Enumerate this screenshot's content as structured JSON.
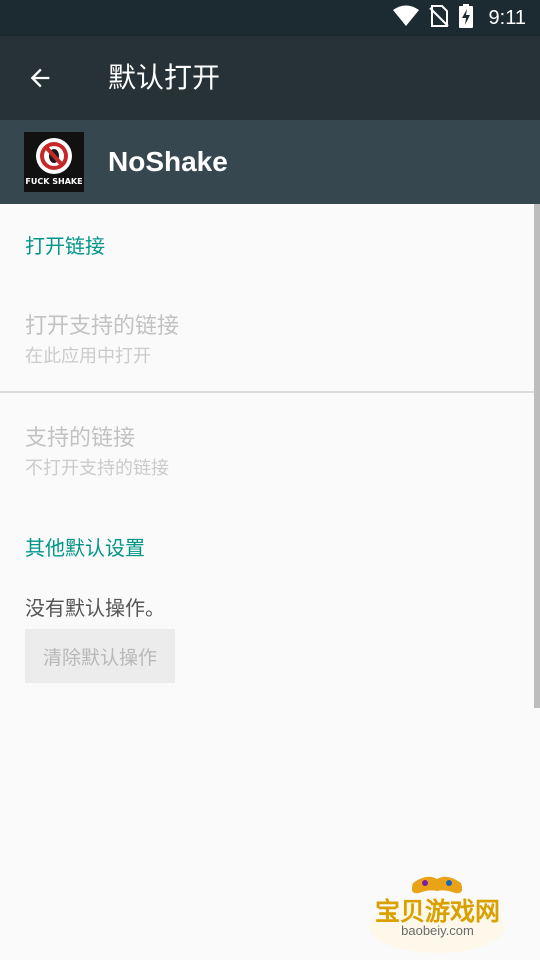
{
  "status_bar": {
    "time": "9:11",
    "icons": [
      "wifi-icon",
      "no-sim-icon",
      "battery-charging-icon"
    ]
  },
  "toolbar": {
    "title": "默认打开",
    "back_icon": "arrow-back-icon"
  },
  "app": {
    "name": "NoShake",
    "icon_text": "FUCK SHAKE"
  },
  "sections": {
    "open_links": {
      "header": "打开链接",
      "open_supported": {
        "title": "打开支持的链接",
        "summary": "在此应用中打开"
      },
      "supported_links": {
        "title": "支持的链接",
        "summary": "不打开支持的链接"
      }
    },
    "other_defaults": {
      "header": "其他默认设置",
      "no_default_text": "没有默认操作。",
      "clear_button": "清除默认操作"
    }
  },
  "watermark": {
    "cn": "宝贝游戏网",
    "url": "baobeiy.com"
  },
  "colors": {
    "toolbar": "#263238",
    "status_bar": "#1c2a31",
    "app_header": "#37474f",
    "accent": "#009688",
    "background": "#fafafa"
  }
}
